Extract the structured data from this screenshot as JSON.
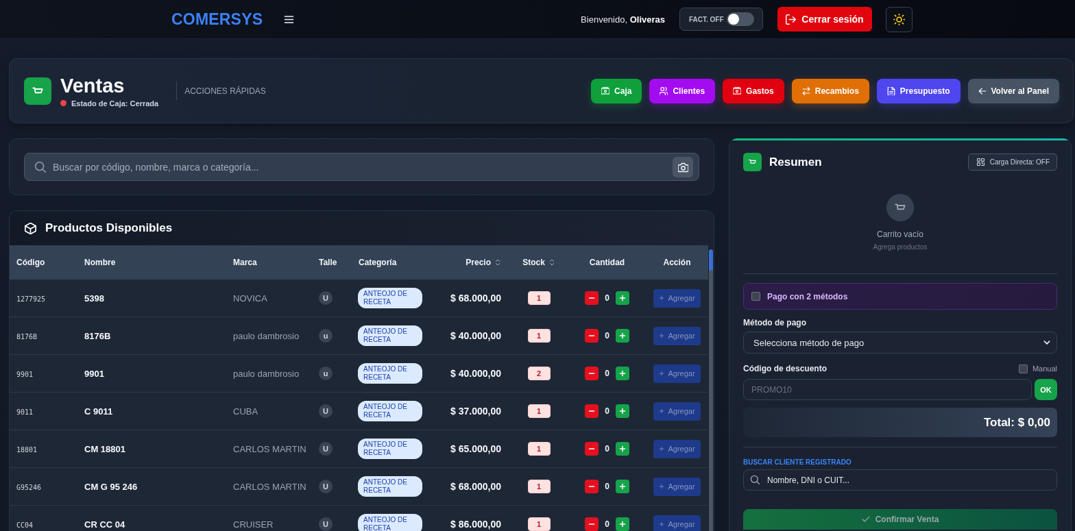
{
  "topbar": {
    "logo": "COMERSYS",
    "greeting": "Bienvenido, **Oliveras**",
    "invoice_toggle": {
      "label": "FACT. OFF",
      "on": false
    },
    "logout_button": "Cerrar sesión"
  },
  "header": {
    "title": "Ventas",
    "cash_status": {
      "text": "Estado de Caja: Cerrada",
      "open": false
    },
    "quick_actions_label": "ACCIONES RÁPIDAS",
    "actions": [
      {
        "label": "Caja",
        "kind": "cash",
        "color": "#0fa03c"
      },
      {
        "label": "Clientes",
        "kind": "clients",
        "color": "#a30cf0"
      },
      {
        "label": "Gastos",
        "kind": "expenses",
        "color": "#e0000f"
      },
      {
        "label": "Recambios",
        "kind": "exchange",
        "color": "#e07006"
      },
      {
        "label": "Presupuesto",
        "kind": "quote",
        "color": "#4f46f0"
      },
      {
        "label": "Volver al Panel",
        "kind": "back",
        "color": "#475263"
      }
    ]
  },
  "search": {
    "placeholder": "Buscar por código, nombre, marca o categoría..."
  },
  "products": {
    "title": "Productos Disponibles",
    "columns": [
      {
        "label": "Código",
        "sortable": false
      },
      {
        "label": "Nombre",
        "sortable": false
      },
      {
        "label": "Marca",
        "sortable": false
      },
      {
        "label": "Talle",
        "sortable": false
      },
      {
        "label": "Categoría",
        "sortable": false
      },
      {
        "label": "Precio",
        "sortable": true
      },
      {
        "label": "Stock",
        "sortable": true
      },
      {
        "label": "Cantidad",
        "sortable": false
      },
      {
        "label": "Acción",
        "sortable": false
      }
    ],
    "rows": [
      {
        "code": "1277925",
        "name": "5398",
        "brand": "NOVICA",
        "size": "U",
        "category": "ANTEOJO DE RECETA",
        "price": "$ 68.000,00",
        "stock": "1",
        "quantity": "0",
        "action": "Agregar",
        "action_disabled": true
      },
      {
        "code": "8176B",
        "name": "8176B",
        "brand": "paulo dambrosio",
        "size": "u",
        "category": "ANTEOJO DE RECETA",
        "price": "$ 40.000,00",
        "stock": "1",
        "quantity": "0",
        "action": "Agregar",
        "action_disabled": true
      },
      {
        "code": "9901",
        "name": "9901",
        "brand": "paulo dambrosio",
        "size": "u",
        "category": "ANTEOJO DE RECETA",
        "price": "$ 40.000,00",
        "stock": "2",
        "quantity": "0",
        "action": "Agregar",
        "action_disabled": true
      },
      {
        "code": "9011",
        "name": "C 9011",
        "brand": "CUBA",
        "size": "U",
        "category": "ANTEOJO DE RECETA",
        "price": "$ 37.000,00",
        "stock": "1",
        "quantity": "0",
        "action": "Agregar",
        "action_disabled": true
      },
      {
        "code": "18801",
        "name": "CM 18801",
        "brand": "CARLOS MARTIN",
        "size": "U",
        "category": "ANTEOJO DE RECETA",
        "price": "$ 65.000,00",
        "stock": "1",
        "quantity": "0",
        "action": "Agregar",
        "action_disabled": true
      },
      {
        "code": "G95246",
        "name": "CM G 95 246",
        "brand": "CARLOS MARTIN",
        "size": "U",
        "category": "ANTEOJO DE RECETA",
        "price": "$ 68.000,00",
        "stock": "1",
        "quantity": "0",
        "action": "Agregar",
        "action_disabled": true
      },
      {
        "code": "CC04",
        "name": "CR CC 04",
        "brand": "CRUISER",
        "size": "U",
        "category": "ANTEOJO DE RECETA",
        "price": "$ 86.000,00",
        "stock": "1",
        "quantity": "0",
        "action": "Agregar",
        "action_disabled": true
      }
    ]
  },
  "summary": {
    "title": "Resumen",
    "direct_load_button": "Carga Directa: OFF",
    "empty_cart": {
      "title": "Carrito vacío",
      "subtitle": "Agrega productos"
    },
    "split_payment": {
      "label": "Pago con 2 métodos",
      "checked": false
    },
    "payment_method": {
      "label": "Método de pago",
      "value": "Selecciona método de pago"
    },
    "discount": {
      "label": "Código de descuento",
      "manual": {
        "label": "Manual",
        "checked": false
      },
      "placeholder": "PROMO10",
      "apply_button": "OK"
    },
    "total": "Total: $ 0,00",
    "client_search": {
      "label": "BUSCAR CLIENTE REGISTRADO",
      "placeholder": "Nombre, DNI o CUIT..."
    },
    "confirm_button": {
      "label": "Confirmar Venta",
      "disabled": true
    }
  }
}
